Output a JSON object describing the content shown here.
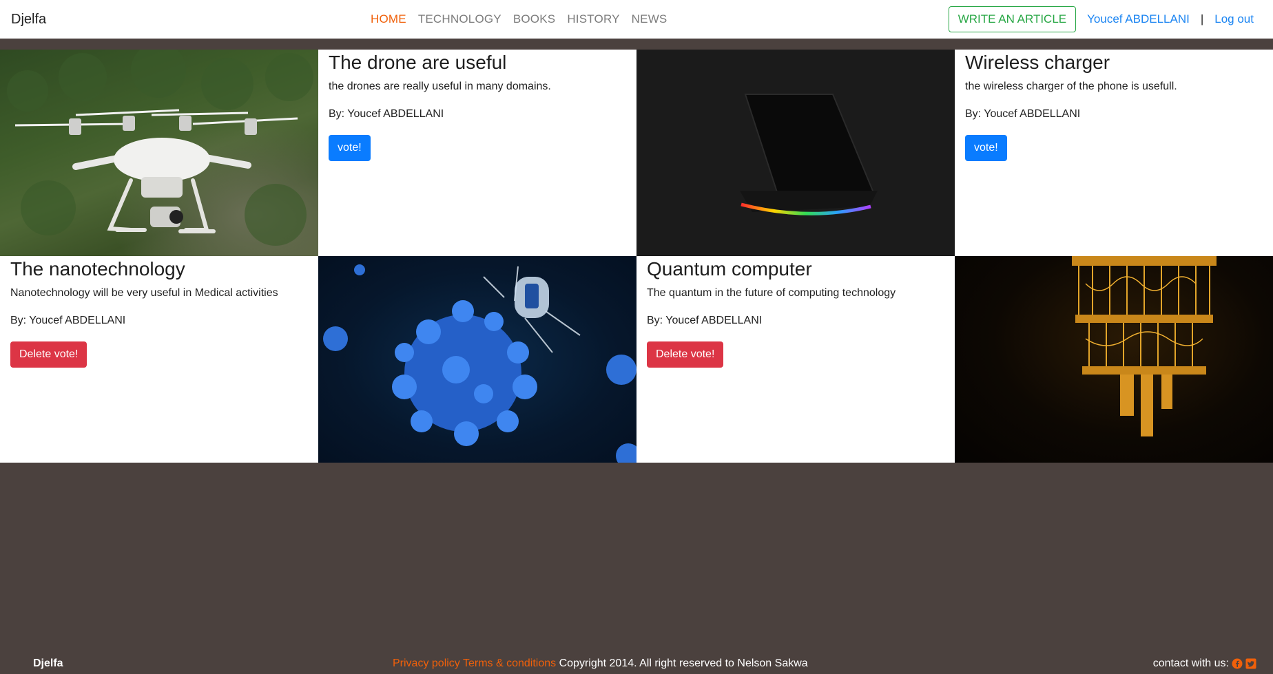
{
  "navbar": {
    "brand": "Djelfa",
    "links": [
      {
        "label": "HOME",
        "active": true
      },
      {
        "label": "TECHNOLOGY",
        "active": false
      },
      {
        "label": "BOOKS",
        "active": false
      },
      {
        "label": "HISTORY",
        "active": false
      },
      {
        "label": "NEWS",
        "active": false
      }
    ],
    "write_article": "WRITE AN ARTICLE",
    "user_name": "Youcef ABDELLANI",
    "separator": "|",
    "logout": "Log out"
  },
  "articles": [
    {
      "title": "The drone are useful",
      "description": "the drones are really useful in many domains.",
      "author": "By: Youcef ABDELLANI",
      "button": "vote!",
      "image": "drone-image"
    },
    {
      "title": "Wireless charger",
      "description": "the wireless charger of the phone is usefull.",
      "author": "By: Youcef ABDELLANI",
      "button": "vote!",
      "image": "wireless-charger-image"
    },
    {
      "title": "The nanotechnology",
      "description": "Nanotechnology will be very useful in Medical activities",
      "author": "By: Youcef ABDELLANI",
      "button": "Delete vote!",
      "image": "nanotechnology-image"
    },
    {
      "title": "Quantum computer",
      "description": "The quantum in the future of computing technology",
      "author": "By: Youcef ABDELLANI",
      "button": "Delete vote!",
      "image": "quantum-computer-image"
    }
  ],
  "footer": {
    "brand": "Djelfa",
    "privacy": "Privacy policy",
    "terms": "Terms & conditions",
    "copyright": "Copyright 2014. All right reserved to Nelson Sakwa",
    "contact": "contact with us:",
    "icons": [
      "facebook-icon",
      "twitter-icon"
    ]
  },
  "colors": {
    "accent": "#f0600a",
    "page_bg": "#4b413e",
    "vote_button": "#0a7cff",
    "delete_button": "#dc3545",
    "write_button": "#28a745",
    "link": "#1a84f2"
  }
}
